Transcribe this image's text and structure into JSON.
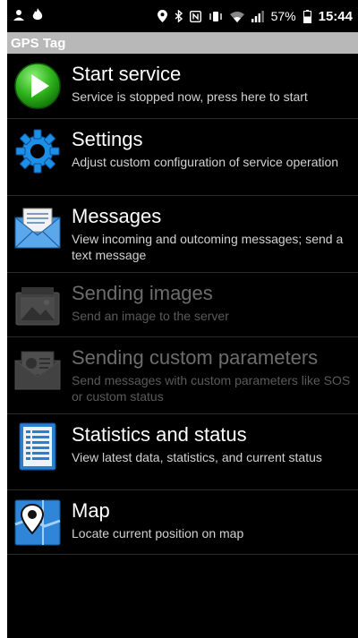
{
  "status_bar": {
    "icons_left": [
      "notification-icon",
      "fire-icon"
    ],
    "icons_right": [
      "location-pin-icon",
      "bluetooth-icon",
      "nfc-icon",
      "vibrate-icon",
      "wifi-icon",
      "signal-icon",
      "battery-icon"
    ],
    "battery": "57%",
    "time": "15:44"
  },
  "app": {
    "title": "GPS Tag"
  },
  "menu": {
    "items": [
      {
        "label": "Start service",
        "description": "Service is stopped now, press here to start",
        "icon": "play-icon",
        "enabled": true
      },
      {
        "label": "Settings",
        "description": "Adjust custom configuration of service operation",
        "icon": "gear-icon",
        "enabled": true
      },
      {
        "label": "Messages",
        "description": "View incoming and outcoming messages; send a text message",
        "icon": "envelope-icon",
        "enabled": true
      },
      {
        "label": "Sending images",
        "description": "Send an image to the server",
        "icon": "image-icon",
        "enabled": false
      },
      {
        "label": "Sending custom parameters",
        "description": "Send messages with custom parameters like SOS or custom status",
        "icon": "custom-params-icon",
        "enabled": false
      },
      {
        "label": "Statistics and status",
        "description": "View latest data, statistics, and current status",
        "icon": "statistics-icon",
        "enabled": true
      },
      {
        "label": "Map",
        "description": "Locate current position on map",
        "icon": "map-icon",
        "enabled": true
      }
    ]
  },
  "colors": {
    "background": "#000000",
    "titlebar": "#b8b8b8",
    "text": "#ffffff",
    "disabled_text": "#6c6c6c"
  }
}
